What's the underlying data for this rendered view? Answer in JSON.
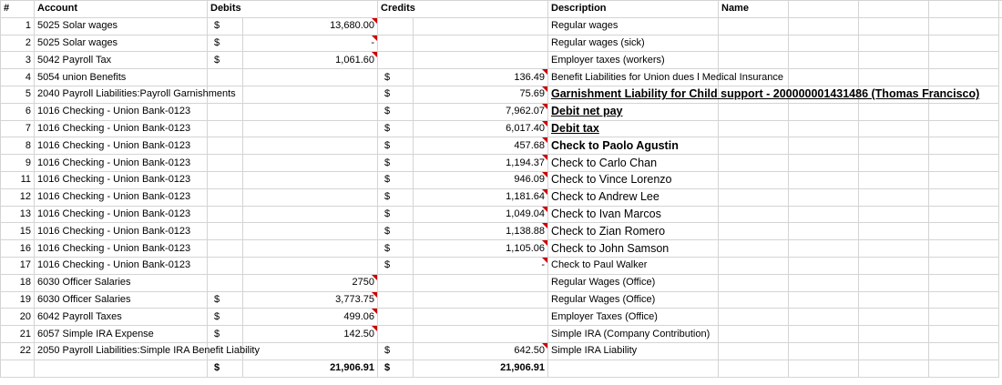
{
  "headers": {
    "index": "#",
    "account": "Account",
    "debits": "Debits",
    "credits": "Credits",
    "description": "Description",
    "name": "Name"
  },
  "currency_symbol": "$",
  "rows": [
    {
      "idx": "1",
      "account": "5025 Solar wages",
      "debit_cur": "$",
      "debit": "13,680.00",
      "credit_cur": "",
      "credit": "",
      "description": "Regular wages",
      "style": "normal"
    },
    {
      "idx": "2",
      "account": "5025 Solar wages",
      "debit_cur": "$",
      "debit": "-",
      "credit_cur": "",
      "credit": "",
      "description": "Regular wages (sick)",
      "style": "normal"
    },
    {
      "idx": "3",
      "account": "5042 Payroll Tax",
      "debit_cur": "$",
      "debit": "1,061.60",
      "credit_cur": "",
      "credit": "",
      "description": "Employer taxes (workers)",
      "style": "normal"
    },
    {
      "idx": "4",
      "account": "5054 union Benefits",
      "debit_cur": "",
      "debit": "",
      "credit_cur": "$",
      "credit": "136.49",
      "description": "Benefit Liabilities for Union dues l Medical Insurance",
      "style": "normal"
    },
    {
      "idx": "5",
      "account": "2040 Payroll Liabilities:Payroll Garnishments",
      "debit_cur": "",
      "debit": "",
      "credit_cur": "$",
      "credit": "75.69",
      "description": "Garnishment Liability for Child support -  200000001431486 (Thomas Francisco)",
      "style": "bold-ul"
    },
    {
      "idx": "6",
      "account": "1016 Checking - Union Bank-0123",
      "debit_cur": "",
      "debit": "",
      "credit_cur": "$",
      "credit": "7,962.07",
      "description": "Debit net pay",
      "style": "bold-ul"
    },
    {
      "idx": "7",
      "account": "1016 Checking - Union Bank-0123",
      "debit_cur": "",
      "debit": "",
      "credit_cur": "$",
      "credit": "6,017.40",
      "description": "Debit tax",
      "style": "bold-ul"
    },
    {
      "idx": "8",
      "account": "1016 Checking - Union Bank-0123",
      "debit_cur": "",
      "debit": "",
      "credit_cur": "$",
      "credit": "457.68",
      "description": "Check to Paolo Agustin",
      "style": "bold"
    },
    {
      "idx": "9",
      "account": "1016 Checking - Union Bank-0123",
      "debit_cur": "",
      "debit": "",
      "credit_cur": "$",
      "credit": "1,194.37",
      "description": "Check to Carlo Chan",
      "style": "big"
    },
    {
      "idx": "11",
      "account": "1016 Checking - Union Bank-0123",
      "debit_cur": "",
      "debit": "",
      "credit_cur": "$",
      "credit": "946.09",
      "description": "Check to Vince Lorenzo",
      "style": "big"
    },
    {
      "idx": "12",
      "account": "1016 Checking - Union Bank-0123",
      "debit_cur": "",
      "debit": "",
      "credit_cur": "$",
      "credit": "1,181.64",
      "description": "Check to Andrew Lee",
      "style": "big"
    },
    {
      "idx": "13",
      "account": "1016 Checking - Union Bank-0123",
      "debit_cur": "",
      "debit": "",
      "credit_cur": "$",
      "credit": "1,049.04",
      "description": "Check to Ivan Marcos",
      "style": "big"
    },
    {
      "idx": "15",
      "account": "1016 Checking - Union Bank-0123",
      "debit_cur": "",
      "debit": "",
      "credit_cur": "$",
      "credit": "1,138.88",
      "description": "Check to Zian Romero",
      "style": "big"
    },
    {
      "idx": "16",
      "account": "1016 Checking - Union Bank-0123",
      "debit_cur": "",
      "debit": "",
      "credit_cur": "$",
      "credit": "1,105.06",
      "description": "Check to John Samson",
      "style": "big"
    },
    {
      "idx": "17",
      "account": "1016 Checking - Union Bank-0123",
      "debit_cur": "",
      "debit": "",
      "credit_cur": "$",
      "credit": "-",
      "description": "Check to Paul Walker",
      "style": "normal"
    },
    {
      "idx": "18",
      "account": "6030 Officer Salaries",
      "debit_cur": "",
      "debit": "2750",
      "credit_cur": "",
      "credit": "",
      "description": "Regular Wages (Office)",
      "style": "normal"
    },
    {
      "idx": "19",
      "account": "6030 Officer Salaries",
      "debit_cur": "$",
      "debit": "3,773.75",
      "credit_cur": "",
      "credit": "",
      "description": "Regular Wages (Office)",
      "style": "normal"
    },
    {
      "idx": "20",
      "account": "6042 Payroll Taxes",
      "debit_cur": "$",
      "debit": "499.06",
      "credit_cur": "",
      "credit": "",
      "description": "Employer Taxes (Office)",
      "style": "normal"
    },
    {
      "idx": "21",
      "account": "6057 Simple IRA Expense",
      "debit_cur": "$",
      "debit": "142.50",
      "credit_cur": "",
      "credit": "",
      "description": "Simple IRA (Company Contribution)",
      "style": "normal"
    },
    {
      "idx": "22",
      "account": "2050 Payroll Liabilities:Simple IRA Benefit Liability",
      "debit_cur": "",
      "debit": "",
      "credit_cur": "$",
      "credit": "642.50",
      "description": "Simple IRA Liability",
      "style": "normal"
    }
  ],
  "totals": {
    "debit_cur": "$",
    "debit": "21,906.91",
    "credit_cur": "$",
    "credit": "21,906.91"
  }
}
